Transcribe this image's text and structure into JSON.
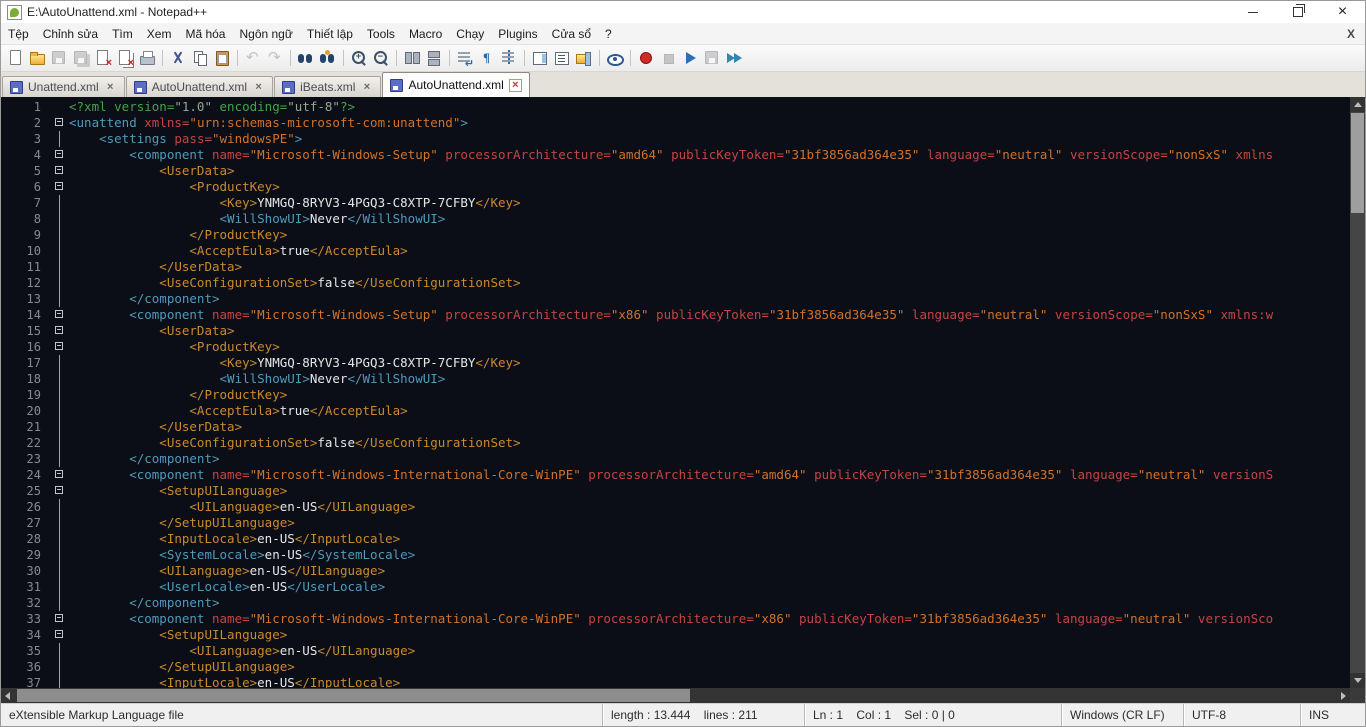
{
  "window": {
    "title": "E:\\AutoUnattend.xml - Notepad++"
  },
  "menu": {
    "items": [
      {
        "id": "file",
        "label": "Tệp"
      },
      {
        "id": "edit",
        "label": "Chỉnh sửa"
      },
      {
        "id": "search",
        "label": "Tìm"
      },
      {
        "id": "view",
        "label": "Xem"
      },
      {
        "id": "encoding",
        "label": "Mã hóa"
      },
      {
        "id": "language",
        "label": "Ngôn ngữ"
      },
      {
        "id": "settings",
        "label": "Thiết lập"
      },
      {
        "id": "tools",
        "label": "Tools"
      },
      {
        "id": "macro",
        "label": "Macro"
      },
      {
        "id": "run",
        "label": "Chạy"
      },
      {
        "id": "plugins",
        "label": "Plugins"
      },
      {
        "id": "window",
        "label": "Cửa sổ"
      },
      {
        "id": "help",
        "label": "?"
      }
    ],
    "right_close": "X"
  },
  "toolbar": {
    "items": [
      {
        "name": "new-file",
        "type": "new",
        "enabled": true
      },
      {
        "name": "open-file",
        "type": "open",
        "enabled": true
      },
      {
        "name": "save-file",
        "type": "save",
        "enabled": false
      },
      {
        "name": "save-all",
        "type": "saveall",
        "enabled": false
      },
      {
        "name": "close-file",
        "type": "close",
        "enabled": true
      },
      {
        "name": "close-all",
        "type": "closeall",
        "enabled": true
      },
      {
        "name": "print",
        "type": "print",
        "enabled": true
      },
      {
        "type": "sep"
      },
      {
        "name": "cut",
        "type": "cut",
        "enabled": true
      },
      {
        "name": "copy",
        "type": "copy",
        "enabled": true
      },
      {
        "name": "paste",
        "type": "paste",
        "enabled": true
      },
      {
        "type": "sep"
      },
      {
        "name": "undo",
        "type": "undo",
        "enabled": false
      },
      {
        "name": "redo",
        "type": "redo",
        "enabled": false
      },
      {
        "type": "sep"
      },
      {
        "name": "find",
        "type": "find",
        "enabled": true
      },
      {
        "name": "replace",
        "type": "replace",
        "enabled": true
      },
      {
        "type": "sep"
      },
      {
        "name": "zoom-in",
        "type": "zoomin",
        "enabled": true
      },
      {
        "name": "zoom-out",
        "type": "zoomout",
        "enabled": true
      },
      {
        "type": "sep"
      },
      {
        "name": "sync-vertical-scroll",
        "type": "syncv",
        "enabled": true
      },
      {
        "name": "sync-horizontal-scroll",
        "type": "synch",
        "enabled": true
      },
      {
        "type": "sep"
      },
      {
        "name": "word-wrap",
        "type": "wrap",
        "enabled": true
      },
      {
        "name": "show-all-characters",
        "type": "showall",
        "enabled": true
      },
      {
        "name": "indent-guide",
        "type": "guide",
        "enabled": true
      },
      {
        "type": "sep"
      },
      {
        "name": "document-map",
        "type": "docmap",
        "enabled": true
      },
      {
        "name": "function-list",
        "type": "funclist",
        "enabled": true
      },
      {
        "name": "folder-as-workspace",
        "type": "workspace",
        "enabled": true
      },
      {
        "type": "sep"
      },
      {
        "name": "monitoring",
        "type": "monitor",
        "enabled": true
      },
      {
        "type": "sep"
      },
      {
        "name": "record-macro",
        "type": "record",
        "enabled": true
      },
      {
        "name": "stop-recording",
        "type": "stop",
        "enabled": false
      },
      {
        "name": "play-macro",
        "type": "play",
        "enabled": true
      },
      {
        "name": "save-macro",
        "type": "savemacro",
        "enabled": false
      },
      {
        "name": "run-macro-multiple-times",
        "type": "runmulti",
        "enabled": true
      }
    ]
  },
  "tabs": [
    {
      "id": "unattend-xml",
      "label": "Unattend.xml",
      "active": false
    },
    {
      "id": "autounattend-xml-1",
      "label": "AutoUnattend.xml",
      "active": false
    },
    {
      "id": "ibeats-xml",
      "label": "iBeats.xml",
      "active": false
    },
    {
      "id": "autounattend-xml-2",
      "label": "AutoUnattend.xml",
      "active": true
    }
  ],
  "editor": {
    "lines": [
      {
        "n": 1,
        "m": "none",
        "tokens": [
          [
            "decl",
            "<?xml version="
          ],
          [
            "dval",
            "\"1.0\""
          ],
          [
            "decl",
            " encoding="
          ],
          [
            "dval",
            "\"utf-8\""
          ],
          [
            "decl",
            "?>"
          ]
        ]
      },
      {
        "n": 2,
        "m": "box",
        "tokens": [
          [
            "tag",
            "<unattend"
          ],
          [
            "attr",
            " xmlns="
          ],
          [
            "val",
            "\"urn:schemas-microsoft-com:unattend\""
          ],
          [
            "tag",
            ">"
          ]
        ]
      },
      {
        "n": 3,
        "m": "line",
        "tokens": [
          [
            "tag",
            "    <settings"
          ],
          [
            "attr",
            " pass="
          ],
          [
            "val",
            "\"windowsPE\""
          ],
          [
            "tag",
            ">"
          ]
        ]
      },
      {
        "n": 4,
        "m": "box",
        "tokens": [
          [
            "tag",
            "        <component"
          ],
          [
            "attr",
            " name="
          ],
          [
            "val",
            "\"Microsoft-Windows-Setup\""
          ],
          [
            "attr",
            " processorArchitecture="
          ],
          [
            "val",
            "\"amd64\""
          ],
          [
            "attr",
            " publicKeyToken="
          ],
          [
            "val",
            "\"31bf3856ad364e35\""
          ],
          [
            "attr",
            " language="
          ],
          [
            "val",
            "\"neutral\""
          ],
          [
            "attr",
            " versionScope="
          ],
          [
            "val",
            "\"nonSxS\""
          ],
          [
            "attr",
            " xmlns"
          ]
        ]
      },
      {
        "n": 5,
        "m": "box",
        "tokens": [
          [
            "tago",
            "            <UserData>"
          ]
        ]
      },
      {
        "n": 6,
        "m": "box",
        "tokens": [
          [
            "tago",
            "                <ProductKey>"
          ]
        ]
      },
      {
        "n": 7,
        "m": "line",
        "tokens": [
          [
            "tago",
            "                    <Key>"
          ],
          [
            "txt",
            "YNMGQ-8RYV3-4PGQ3-C8XTP-7CFBY"
          ],
          [
            "tago",
            "</Key>"
          ]
        ]
      },
      {
        "n": 8,
        "m": "line",
        "tokens": [
          [
            "tag",
            "                    <WillShowUI>"
          ],
          [
            "txt",
            "Never"
          ],
          [
            "tag",
            "</WillShowUI>"
          ]
        ]
      },
      {
        "n": 9,
        "m": "line",
        "tokens": [
          [
            "tago",
            "                </ProductKey>"
          ]
        ]
      },
      {
        "n": 10,
        "m": "line",
        "tokens": [
          [
            "tago",
            "                <AcceptEula>"
          ],
          [
            "txt",
            "true"
          ],
          [
            "tago",
            "</AcceptEula>"
          ]
        ]
      },
      {
        "n": 11,
        "m": "line",
        "tokens": [
          [
            "tago",
            "            </UserData>"
          ]
        ]
      },
      {
        "n": 12,
        "m": "line",
        "tokens": [
          [
            "tago",
            "            <UseConfigurationSet>"
          ],
          [
            "txt",
            "false"
          ],
          [
            "tago",
            "</UseConfigurationSet>"
          ]
        ]
      },
      {
        "n": 13,
        "m": "line",
        "tokens": [
          [
            "tag",
            "        </component>"
          ]
        ]
      },
      {
        "n": 14,
        "m": "box",
        "tokens": [
          [
            "tag",
            "        <component"
          ],
          [
            "attr",
            " name="
          ],
          [
            "val",
            "\"Microsoft-Windows-Setup\""
          ],
          [
            "attr",
            " processorArchitecture="
          ],
          [
            "val",
            "\"x86\""
          ],
          [
            "attr",
            " publicKeyToken="
          ],
          [
            "val",
            "\"31bf3856ad364e35\""
          ],
          [
            "attr",
            " language="
          ],
          [
            "val",
            "\"neutral\""
          ],
          [
            "attr",
            " versionScope="
          ],
          [
            "val",
            "\"nonSxS\""
          ],
          [
            "attr",
            " xmlns:w"
          ]
        ]
      },
      {
        "n": 15,
        "m": "box",
        "tokens": [
          [
            "tago",
            "            <UserData>"
          ]
        ]
      },
      {
        "n": 16,
        "m": "box",
        "tokens": [
          [
            "tago",
            "                <ProductKey>"
          ]
        ]
      },
      {
        "n": 17,
        "m": "line",
        "tokens": [
          [
            "tago",
            "                    <Key>"
          ],
          [
            "txt",
            "YNMGQ-8RYV3-4PGQ3-C8XTP-7CFBY"
          ],
          [
            "tago",
            "</Key>"
          ]
        ]
      },
      {
        "n": 18,
        "m": "line",
        "tokens": [
          [
            "tag",
            "                    <WillShowUI>"
          ],
          [
            "txt",
            "Never"
          ],
          [
            "tag",
            "</WillShowUI>"
          ]
        ]
      },
      {
        "n": 19,
        "m": "line",
        "tokens": [
          [
            "tago",
            "                </ProductKey>"
          ]
        ]
      },
      {
        "n": 20,
        "m": "line",
        "tokens": [
          [
            "tago",
            "                <AcceptEula>"
          ],
          [
            "txt",
            "true"
          ],
          [
            "tago",
            "</AcceptEula>"
          ]
        ]
      },
      {
        "n": 21,
        "m": "line",
        "tokens": [
          [
            "tago",
            "            </UserData>"
          ]
        ]
      },
      {
        "n": 22,
        "m": "line",
        "tokens": [
          [
            "tago",
            "            <UseConfigurationSet>"
          ],
          [
            "txt",
            "false"
          ],
          [
            "tago",
            "</UseConfigurationSet>"
          ]
        ]
      },
      {
        "n": 23,
        "m": "line",
        "tokens": [
          [
            "tag",
            "        </component>"
          ]
        ]
      },
      {
        "n": 24,
        "m": "box",
        "tokens": [
          [
            "tag",
            "        <component"
          ],
          [
            "attr",
            " name="
          ],
          [
            "val",
            "\"Microsoft-Windows-International-Core-WinPE\""
          ],
          [
            "attr",
            " processorArchitecture="
          ],
          [
            "val",
            "\"amd64\""
          ],
          [
            "attr",
            " publicKeyToken="
          ],
          [
            "val",
            "\"31bf3856ad364e35\""
          ],
          [
            "attr",
            " language="
          ],
          [
            "val",
            "\"neutral\""
          ],
          [
            "attr",
            " versionS"
          ]
        ]
      },
      {
        "n": 25,
        "m": "box",
        "tokens": [
          [
            "tago",
            "            <SetupUILanguage>"
          ]
        ]
      },
      {
        "n": 26,
        "m": "line",
        "tokens": [
          [
            "tago",
            "                <UILanguage>"
          ],
          [
            "txt",
            "en-US"
          ],
          [
            "tago",
            "</UILanguage>"
          ]
        ]
      },
      {
        "n": 27,
        "m": "line",
        "tokens": [
          [
            "tago",
            "            </SetupUILanguage>"
          ]
        ]
      },
      {
        "n": 28,
        "m": "line",
        "tokens": [
          [
            "tago",
            "            <InputLocale>"
          ],
          [
            "txt",
            "en-US"
          ],
          [
            "tago",
            "</InputLocale>"
          ]
        ]
      },
      {
        "n": 29,
        "m": "line",
        "tokens": [
          [
            "tag",
            "            <SystemLocale>"
          ],
          [
            "txt",
            "en-US"
          ],
          [
            "tag",
            "</SystemLocale>"
          ]
        ]
      },
      {
        "n": 30,
        "m": "line",
        "tokens": [
          [
            "tago",
            "            <UILanguage>"
          ],
          [
            "txt",
            "en-US"
          ],
          [
            "tago",
            "</UILanguage>"
          ]
        ]
      },
      {
        "n": 31,
        "m": "line",
        "tokens": [
          [
            "tag",
            "            <UserLocale>"
          ],
          [
            "txt",
            "en-US"
          ],
          [
            "tag",
            "</UserLocale>"
          ]
        ]
      },
      {
        "n": 32,
        "m": "line",
        "tokens": [
          [
            "tag",
            "        </component>"
          ]
        ]
      },
      {
        "n": 33,
        "m": "box",
        "tokens": [
          [
            "tag",
            "        <component"
          ],
          [
            "attr",
            " name="
          ],
          [
            "val",
            "\"Microsoft-Windows-International-Core-WinPE\""
          ],
          [
            "attr",
            " processorArchitecture="
          ],
          [
            "val",
            "\"x86\""
          ],
          [
            "attr",
            " publicKeyToken="
          ],
          [
            "val",
            "\"31bf3856ad364e35\""
          ],
          [
            "attr",
            " language="
          ],
          [
            "val",
            "\"neutral\""
          ],
          [
            "attr",
            " versionSco"
          ]
        ]
      },
      {
        "n": 34,
        "m": "box",
        "tokens": [
          [
            "tago",
            "            <SetupUILanguage>"
          ]
        ]
      },
      {
        "n": 35,
        "m": "line",
        "tokens": [
          [
            "tago",
            "                <UILanguage>"
          ],
          [
            "txt",
            "en-US"
          ],
          [
            "tago",
            "</UILanguage>"
          ]
        ]
      },
      {
        "n": 36,
        "m": "line",
        "tokens": [
          [
            "tago",
            "            </SetupUILanguage>"
          ]
        ]
      },
      {
        "n": 37,
        "m": "line",
        "tokens": [
          [
            "tago",
            "            <InputLocale>"
          ],
          [
            "txt",
            "en-US"
          ],
          [
            "tago",
            "</InputLocale>"
          ]
        ]
      }
    ]
  },
  "statusbar": {
    "doc_type": "eXtensible Markup Language file",
    "length_lines": "length : 13.444    lines : 211",
    "position": "Ln : 1    Col : 1    Sel : 0 | 0",
    "eol": "Windows (CR LF)",
    "encoding": "UTF-8",
    "mode": "INS"
  },
  "colors": {
    "editor_bg": "#0b0e17",
    "gutter_gray": "#8a8a8a",
    "decl_green": "#44a348",
    "decl_value_gray": "#9aa58f",
    "tag_blue": "#4f9ab8",
    "tag_orange": "#c98a2e",
    "attr_red": "#c24545",
    "value_orange": "#d0722a",
    "content_white": "#e6e6e6"
  }
}
